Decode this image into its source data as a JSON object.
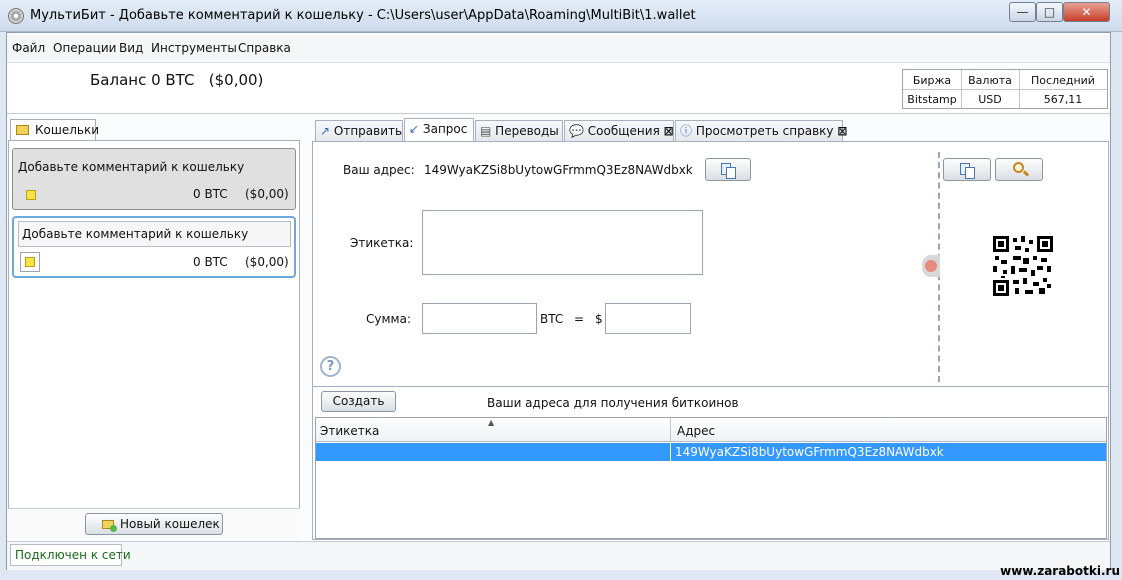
{
  "window": {
    "title": "МультиБит - Добавьте комментарий к кошельку - C:\\Users\\user\\AppData\\Roaming\\MultiBit\\1.wallet",
    "minimize": "—",
    "maximize": "□",
    "close": "✕"
  },
  "menu": [
    "Файл",
    "Операции",
    "Вид",
    "Инструменты",
    "Справка"
  ],
  "balance": {
    "text": "Баланс 0 BTC",
    "fiat": "($0,00)"
  },
  "exchange": {
    "headers": [
      "Биржа",
      "Валюта",
      "Последний"
    ],
    "row": [
      "Bitstamp",
      "USD",
      "567,11"
    ]
  },
  "wallets_tab": "Кошельки",
  "wallets": [
    {
      "name": "Добавьте комментарий к кошельку",
      "btc": "0 BTC",
      "fiat": "($0,00)"
    },
    {
      "name": "Добавьте комментарий к кошельку",
      "btc": "0 BTC",
      "fiat": "($0,00)"
    }
  ],
  "new_wallet_button": "Новый кошелек",
  "tabs": [
    "Отправить",
    "Запрос",
    "Переводы",
    "Сообщения",
    "Просмотреть справку"
  ],
  "request": {
    "address_label": "Ваш адрес:",
    "address": "149WyaKZSi8bUytowGFrmmQ3Ez8NAWdbxk",
    "label_label": "Этикетка:",
    "label_value": "",
    "amount_label": "Сумма:",
    "amount_btc": "",
    "btc_unit": "BTC",
    "equals": "=",
    "dollar": "$",
    "amount_fiat": ""
  },
  "addresses": {
    "create_button": "Создать",
    "title": "Ваши адреса для получения биткоинов",
    "columns": [
      "Этикетка",
      "Адрес"
    ],
    "rows": [
      {
        "label": "",
        "address": "149WyaKZSi8bUytowGFrmmQ3Ez8NAWdbxk"
      }
    ]
  },
  "status": "Подключен к сети",
  "watermark": "www.zarabotki.ru",
  "colors": {
    "selection": "#3399ff",
    "focus_border": "#6fa8dc",
    "online": "#1a6b1a"
  }
}
